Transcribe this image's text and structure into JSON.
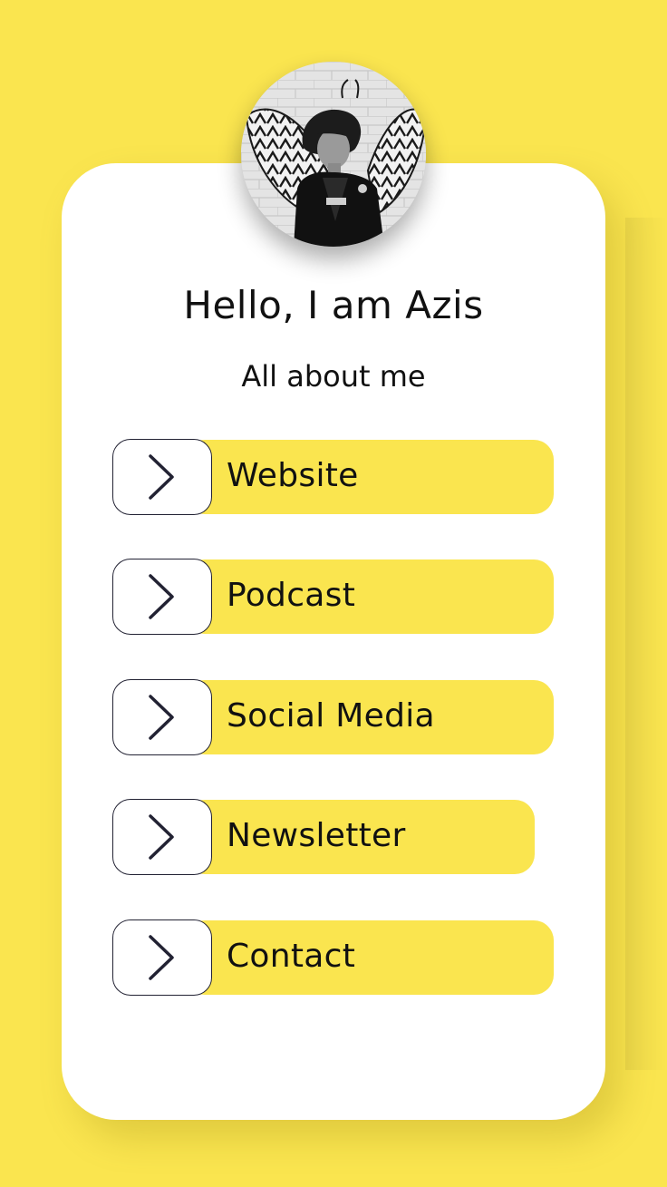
{
  "profile": {
    "greeting": "Hello, I am Azis",
    "subtitle": "All about me",
    "avatar": "profile-photo-man-in-front-of-wing-mural"
  },
  "links": [
    {
      "label": "Website",
      "icon": "chevron-right-icon"
    },
    {
      "label": "Podcast",
      "icon": "chevron-right-icon"
    },
    {
      "label": "Social Media",
      "icon": "chevron-right-icon"
    },
    {
      "label": "Newsletter",
      "icon": "chevron-right-icon"
    },
    {
      "label": "Contact",
      "icon": "chevron-right-icon"
    }
  ],
  "colors": {
    "background": "#fae54f",
    "card": "#ffffff",
    "pill": "#fae54f",
    "text": "#111111",
    "arrow": "#222233"
  }
}
